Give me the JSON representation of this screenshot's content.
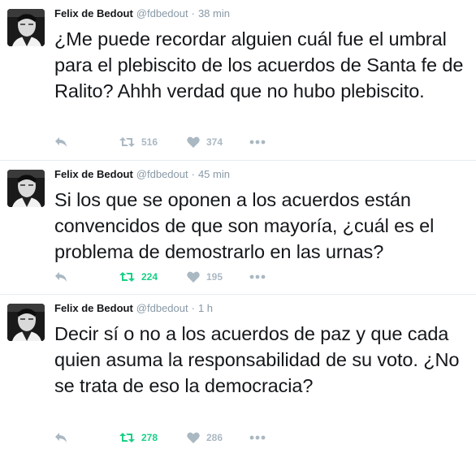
{
  "colors": {
    "retweeted": "#19cf86",
    "action_gray": "#aab8c2",
    "meta_gray": "#8899a6",
    "text": "#14171a"
  },
  "tweets": [
    {
      "name": "Felix de Bedout",
      "handle": "@fdbedout",
      "separator": "·",
      "time": "38 min",
      "text": "¿Me puede recordar alguien cuál fue el umbral para el plebiscito de los acuerdos de Santa fe de Ralito? Ahhh verdad que no hubo plebiscito.",
      "retweets": "516",
      "likes": "374",
      "retweeted": false,
      "icons": [
        "reply-icon",
        "retweet-icon",
        "like-icon",
        "more-icon"
      ]
    },
    {
      "name": "Felix de Bedout",
      "handle": "@fdbedout",
      "separator": "·",
      "time": "45 min",
      "text": "Si los que se oponen a los acuerdos están convencidos de que son mayoría, ¿cuál es el problema de demostrarlo en las urnas?",
      "retweets": "224",
      "likes": "195",
      "retweeted": true,
      "icons": [
        "reply-icon",
        "retweet-icon",
        "like-icon",
        "more-icon"
      ]
    },
    {
      "name": "Felix de Bedout",
      "handle": "@fdbedout",
      "separator": "·",
      "time": "1 h",
      "text": "Decir sí o no a los acuerdos de paz y que cada quien asuma la responsabilidad de su voto. ¿No se trata de eso la democracia?",
      "retweets": "278",
      "likes": "286",
      "retweeted": true,
      "icons": [
        "reply-icon",
        "retweet-icon",
        "like-icon",
        "more-icon"
      ]
    }
  ]
}
